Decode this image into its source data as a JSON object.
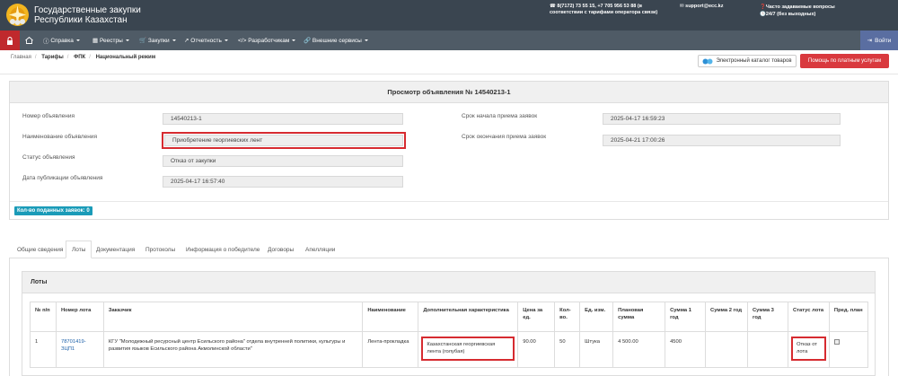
{
  "header": {
    "brand_line1": "Государственные закупки",
    "brand_line2": "Республики Казахстан",
    "phone_line1": "8(7172) 73 55 15, +7 705 956 53 88 (в",
    "phone_line2": "соответствии с тарифами оператора связи)",
    "support_email": "support@ecc.kz",
    "faq": "Часто задаваемые вопросы",
    "hours": "24/7 (без выходных)"
  },
  "nav": {
    "items": [
      "Справка",
      "Реестры",
      "Закупки",
      "Отчетность",
      "Разработчикам",
      "Внешние сервисы"
    ],
    "login": "Войти"
  },
  "breadcrumb": [
    "Главная",
    "Тарифы",
    "ФПК",
    "Национальный режим"
  ],
  "catalog_button": "Электронный каталог товаров",
  "help_button": "Помощь по платным услугам",
  "announcement": {
    "title": "Просмотр объявления № 14540213-1",
    "number_label": "Номер объявления",
    "number_value": "14540213-1",
    "name_label": "Наименование объявления",
    "name_value": "Приобретение георгиевских лент",
    "status_label": "Статус объявления",
    "status_value": "Отказ от закупки",
    "published_label": "Дата публикации объявления",
    "published_value": "2025-04-17 16:57:40",
    "start_label": "Срок начала приема заявок",
    "start_value": "2025-04-17 16:59:23",
    "end_label": "Срок окончания приема заявок",
    "end_value": "2025-04-21 17:00:26",
    "applications_badge": "Кол-во поданных заявок: 0"
  },
  "tabs": [
    "Общие сведения",
    "Лоты",
    "Документация",
    "Протоколы",
    "Информация о победителе",
    "Договоры",
    "Апелляции"
  ],
  "lots": {
    "title": "Лоты",
    "columns": [
      "№ п/п",
      "Номер лота",
      "Заказчик",
      "Наименование",
      "Дополнительная характеристика",
      "Цена за ед.",
      "Кол-во.",
      "Ед. изм.",
      "Плановая сумма",
      "Сумма 1 год",
      "Сумма 2 год",
      "Сумма 3 год",
      "Статус лота",
      "Пред. план"
    ],
    "row": {
      "num": "1",
      "lot_number": "78701419-ЗЦП1",
      "customer": "КГУ \"Молодежный ресурсный центр Есильского района\" отдела внутренней политики, культуры и развития языков Есильского района Акмолинской области\"",
      "name": "Лента-прокладка",
      "extra": "Казахстанская георгиевская лента (голубая)",
      "price": "90.00",
      "qty": "50",
      "unit": "Штука",
      "planned_sum": "4 500.00",
      "sum1": "4500",
      "sum2": "",
      "sum3": "",
      "status": "Отказ от лота"
    }
  },
  "colors": {
    "header_bg": "#3a4550",
    "nav_bg": "#4f5b66",
    "accent_red": "#d9393e",
    "badge_teal": "#1a9bb8",
    "login_blue": "#5a6ea1"
  }
}
